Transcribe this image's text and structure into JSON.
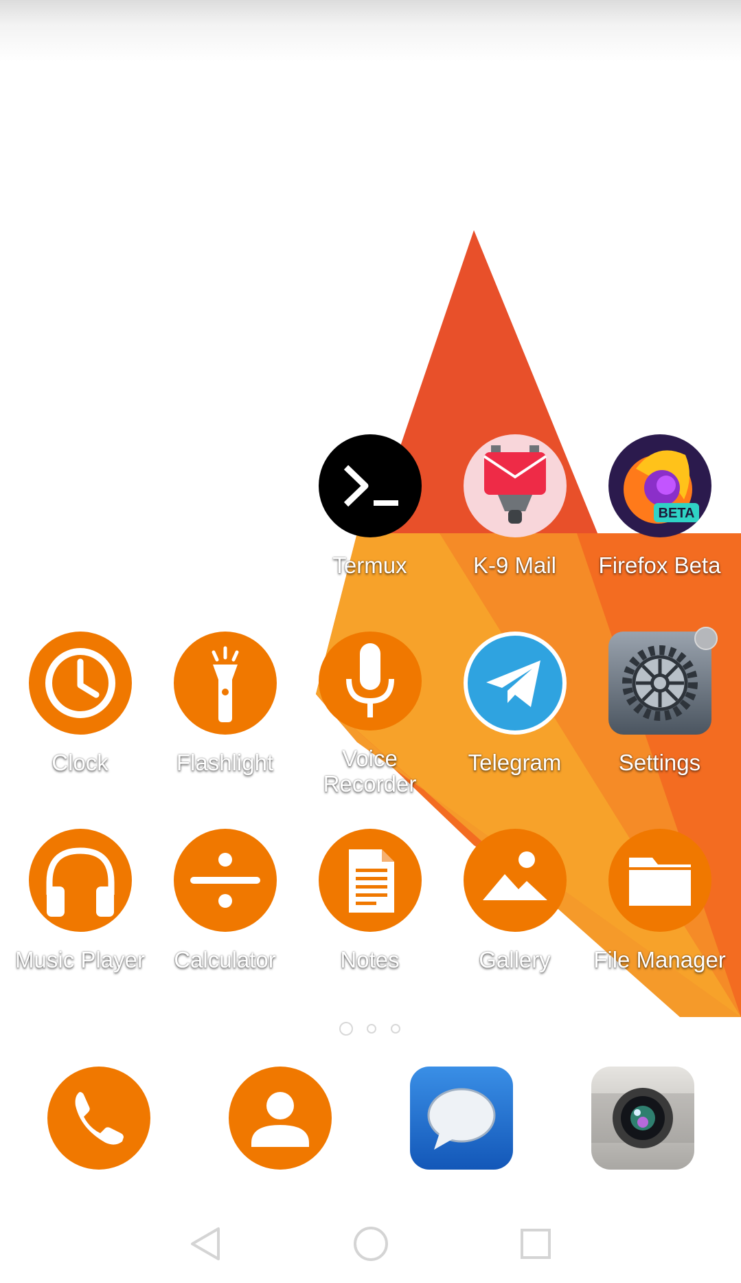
{
  "home_row1": [
    {
      "label": "Termux",
      "icon": "terminal-icon"
    },
    {
      "label": "K-9 Mail",
      "icon": "k9-mail-icon"
    },
    {
      "label": "Firefox Beta",
      "icon": "firefox-icon",
      "badge_text": "BETA"
    }
  ],
  "home_row2": [
    {
      "label": "Clock",
      "icon": "clock-icon"
    },
    {
      "label": "Flashlight",
      "icon": "flashlight-icon"
    },
    {
      "label": "Voice Recorder",
      "icon": "microphone-icon"
    },
    {
      "label": "Telegram",
      "icon": "telegram-icon"
    },
    {
      "label": "Settings",
      "icon": "gear-icon"
    }
  ],
  "home_row3": [
    {
      "label": "Music Player",
      "icon": "headphones-icon"
    },
    {
      "label": "Calculator",
      "icon": "divide-icon"
    },
    {
      "label": "Notes",
      "icon": "document-icon"
    },
    {
      "label": "Gallery",
      "icon": "image-icon"
    },
    {
      "label": "File Manager",
      "icon": "folder-icon"
    }
  ],
  "dock": [
    {
      "icon": "phone-icon"
    },
    {
      "icon": "contacts-icon"
    },
    {
      "icon": "messages-icon"
    },
    {
      "icon": "camera-icon"
    }
  ],
  "page_indicator": {
    "pages": 3,
    "current": 1
  },
  "navigation": [
    "back-icon",
    "home-icon",
    "recents-icon"
  ],
  "colors": {
    "accent": "#f07800",
    "wall_red": "#e04326",
    "wall_orange": "#f36c21",
    "wall_yellow": "#f7a22a"
  }
}
